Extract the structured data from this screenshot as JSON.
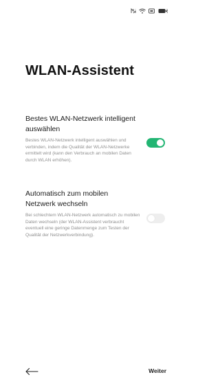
{
  "status_bar": {
    "icons": [
      "nfc-icon",
      "wifi-icon",
      "signal-icon",
      "battery-icon"
    ]
  },
  "page": {
    "title": "WLAN-Assistent"
  },
  "settings": [
    {
      "title": "Bestes WLAN-Netzwerk intelligent auswählen",
      "description": "Bestes WLAN-Netzwerk intelligent auswählen und verbinden, indem die Qualität der WLAN-Netzwerke ermittelt wird (kann den Verbrauch an mobilen Daten durch WLAN erhöhen).",
      "enabled": true
    },
    {
      "title": "Automatisch zum mobilen Netzwerk wechseln",
      "description": "Bei schlechtem WLAN-Netzwerk automatisch zu mobilen Daten wechseln (der WLAN-Assistent verbraucht eventuell eine geringe Datenmenge zum Testen der Qualität der Netzwerkverbindung).",
      "enabled": false
    }
  ],
  "footer": {
    "next_label": "Weiter"
  },
  "colors": {
    "toggle_on": "#22b573",
    "toggle_off": "#eeeeee"
  }
}
